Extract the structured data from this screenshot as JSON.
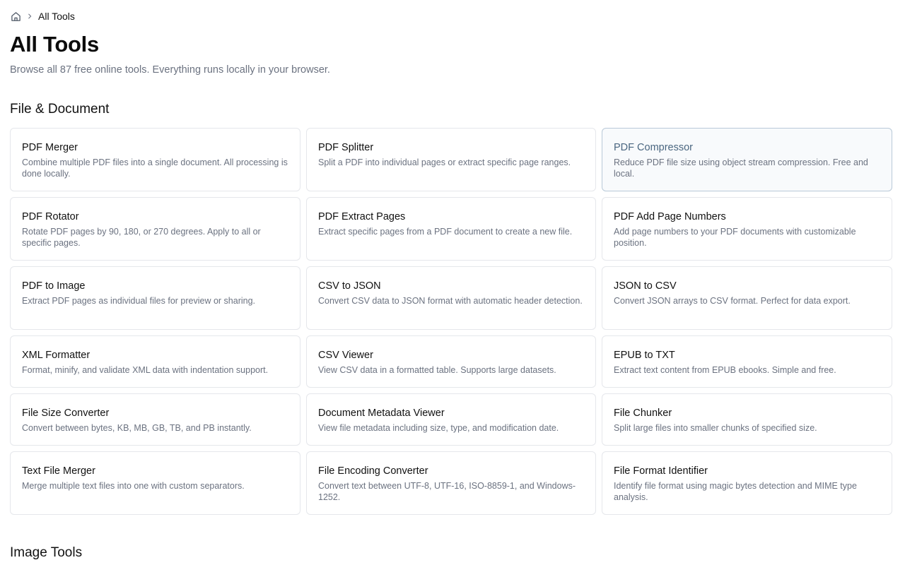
{
  "breadcrumb": {
    "home_icon": "home-icon",
    "separator_icon": "chevron-right-icon",
    "current": "All Tools"
  },
  "header": {
    "title": "All Tools",
    "subtitle": "Browse all 87 free online tools. Everything runs locally in your browser."
  },
  "sections": [
    {
      "title": "File & Document",
      "tools": [
        {
          "name": "PDF Merger",
          "description": "Combine multiple PDF files into a single document. All processing is done locally."
        },
        {
          "name": "PDF Splitter",
          "description": "Split a PDF into individual pages or extract specific page ranges."
        },
        {
          "name": "PDF Compressor",
          "description": "Reduce PDF file size using object stream compression. Free and local."
        },
        {
          "name": "PDF Rotator",
          "description": "Rotate PDF pages by 90, 180, or 270 degrees. Apply to all or specific pages."
        },
        {
          "name": "PDF Extract Pages",
          "description": "Extract specific pages from a PDF document to create a new file."
        },
        {
          "name": "PDF Add Page Numbers",
          "description": "Add page numbers to your PDF documents with customizable position."
        },
        {
          "name": "PDF to Image",
          "description": "Extract PDF pages as individual files for preview or sharing."
        },
        {
          "name": "CSV to JSON",
          "description": "Convert CSV data to JSON format with automatic header detection."
        },
        {
          "name": "JSON to CSV",
          "description": "Convert JSON arrays to CSV format. Perfect for data export."
        },
        {
          "name": "XML Formatter",
          "description": "Format, minify, and validate XML data with indentation support."
        },
        {
          "name": "CSV Viewer",
          "description": "View CSV data in a formatted table. Supports large datasets."
        },
        {
          "name": "EPUB to TXT",
          "description": "Extract text content from EPUB ebooks. Simple and free."
        },
        {
          "name": "File Size Converter",
          "description": "Convert between bytes, KB, MB, GB, TB, and PB instantly."
        },
        {
          "name": "Document Metadata Viewer",
          "description": "View file metadata including size, type, and modification date."
        },
        {
          "name": "File Chunker",
          "description": "Split large files into smaller chunks of specified size."
        },
        {
          "name": "Text File Merger",
          "description": "Merge multiple text files into one with custom separators."
        },
        {
          "name": "File Encoding Converter",
          "description": "Convert text between UTF-8, UTF-16, ISO-8859-1, and Windows-1252."
        },
        {
          "name": "File Format Identifier",
          "description": "Identify file format using magic bytes detection and MIME type analysis."
        }
      ]
    },
    {
      "title": "Image Tools",
      "tools": []
    }
  ],
  "colors": {
    "hover_title": "#4a6680",
    "hover_border": "#b9c9d8",
    "muted_text": "#6b7280",
    "card_border": "#e5e7eb"
  }
}
